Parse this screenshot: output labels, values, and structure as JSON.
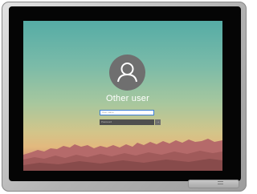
{
  "lock_screen": {
    "user_name": "Other user",
    "username_placeholder": "User name",
    "password_placeholder": "Password",
    "submit_glyph": "→",
    "avatar_icon": "user-icon"
  },
  "colors": {
    "bezel": "#050505",
    "device_frame": "#b3b3b3",
    "avatar_bg": "#6f6f6f",
    "password_field_bg": "#4f4f4f",
    "mountain": "#b56a6a"
  }
}
